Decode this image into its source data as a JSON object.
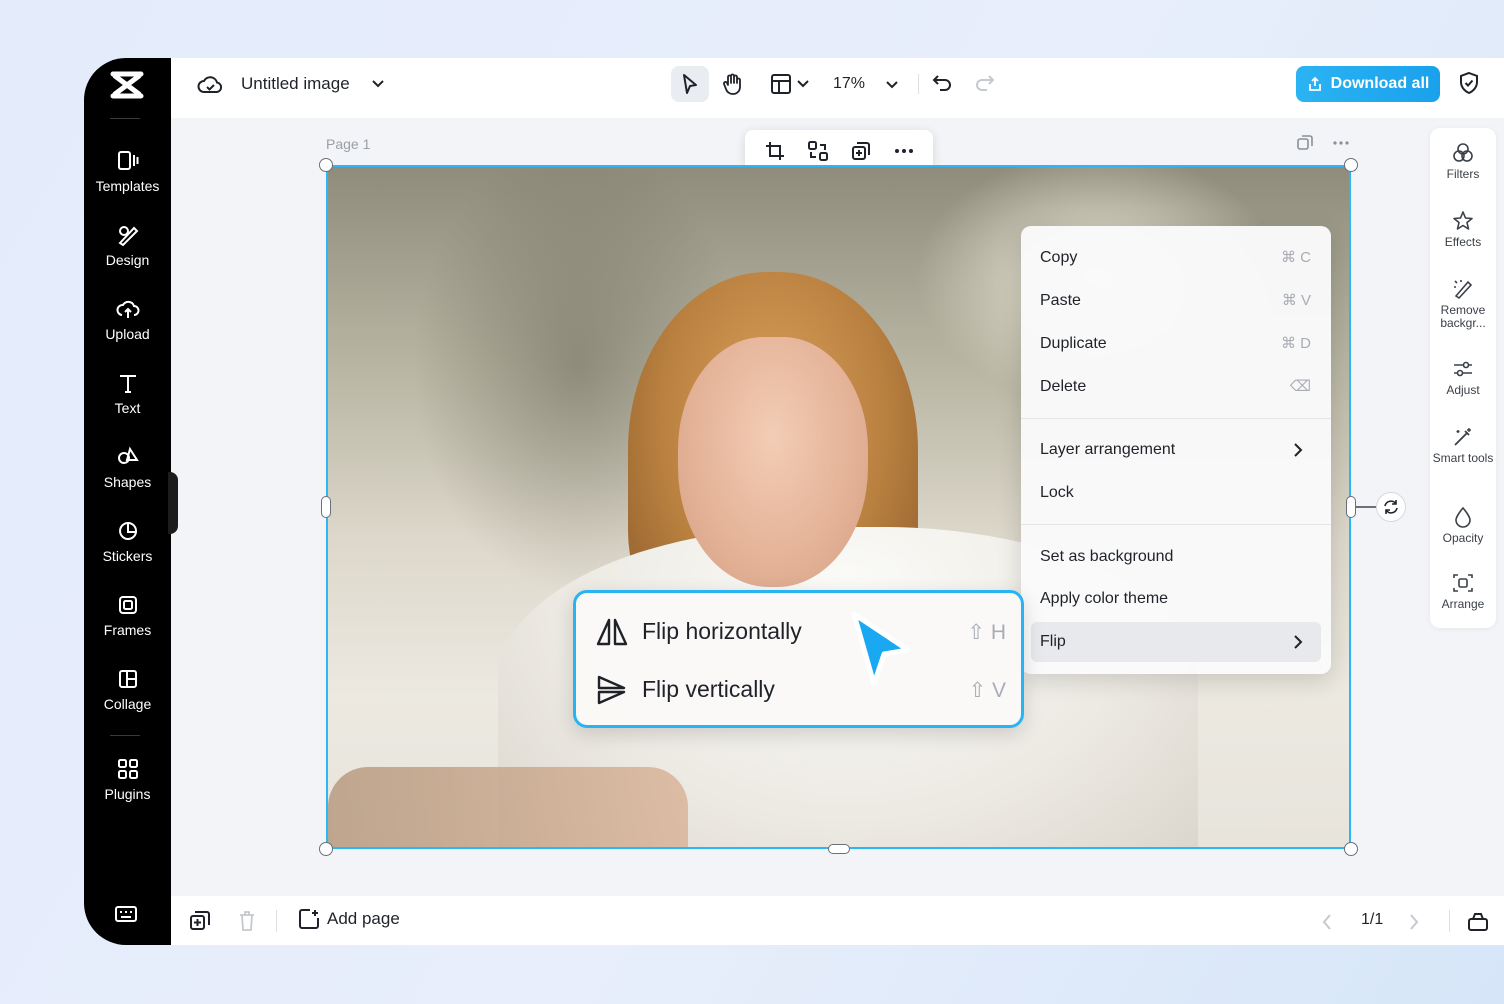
{
  "app": {
    "doc_title": "Untitled image",
    "zoom": "17%",
    "download_label": "Download all"
  },
  "sidebar": {
    "items": [
      {
        "label": "Templates",
        "icon": "templates-icon"
      },
      {
        "label": "Design",
        "icon": "design-icon"
      },
      {
        "label": "Upload",
        "icon": "upload-icon"
      },
      {
        "label": "Text",
        "icon": "text-icon"
      },
      {
        "label": "Shapes",
        "icon": "shapes-icon"
      },
      {
        "label": "Stickers",
        "icon": "stickers-icon"
      },
      {
        "label": "Frames",
        "icon": "frames-icon"
      },
      {
        "label": "Collage",
        "icon": "collage-icon"
      },
      {
        "label": "Plugins",
        "icon": "plugins-icon"
      }
    ]
  },
  "canvas": {
    "page_label": "Page 1"
  },
  "context_menu": {
    "items": [
      {
        "label": "Copy",
        "shortcut": "⌘ C"
      },
      {
        "label": "Paste",
        "shortcut": "⌘ V"
      },
      {
        "label": "Duplicate",
        "shortcut": "⌘ D"
      },
      {
        "label": "Delete",
        "shortcut": "⌫"
      },
      {
        "label": "Layer arrangement",
        "submenu": true
      },
      {
        "label": "Lock"
      },
      {
        "label": "Set as background"
      },
      {
        "label": "Apply color theme"
      },
      {
        "label": "Flip",
        "submenu": true,
        "active": true
      }
    ]
  },
  "flip_menu": {
    "items": [
      {
        "label": "Flip horizontally",
        "shortcut": "⇧ H"
      },
      {
        "label": "Flip vertically",
        "shortcut": "⇧ V"
      }
    ]
  },
  "right_panel": {
    "items": [
      {
        "label": "Filters",
        "icon": "filters-icon"
      },
      {
        "label": "Effects",
        "icon": "effects-icon"
      },
      {
        "label": "Remove backgr...",
        "icon": "remove-background-icon"
      },
      {
        "label": "Adjust",
        "icon": "adjust-icon"
      },
      {
        "label": "Smart tools",
        "icon": "smart-tools-icon"
      },
      {
        "label": "Opacity",
        "icon": "opacity-icon"
      },
      {
        "label": "Arrange",
        "icon": "arrange-icon"
      }
    ]
  },
  "bottombar": {
    "add_page_label": "Add page",
    "page_count": "1/1"
  },
  "colors": {
    "accent": "#2bb3f3",
    "sidebar_bg": "#000000",
    "selection_border": "#2db6f5"
  }
}
